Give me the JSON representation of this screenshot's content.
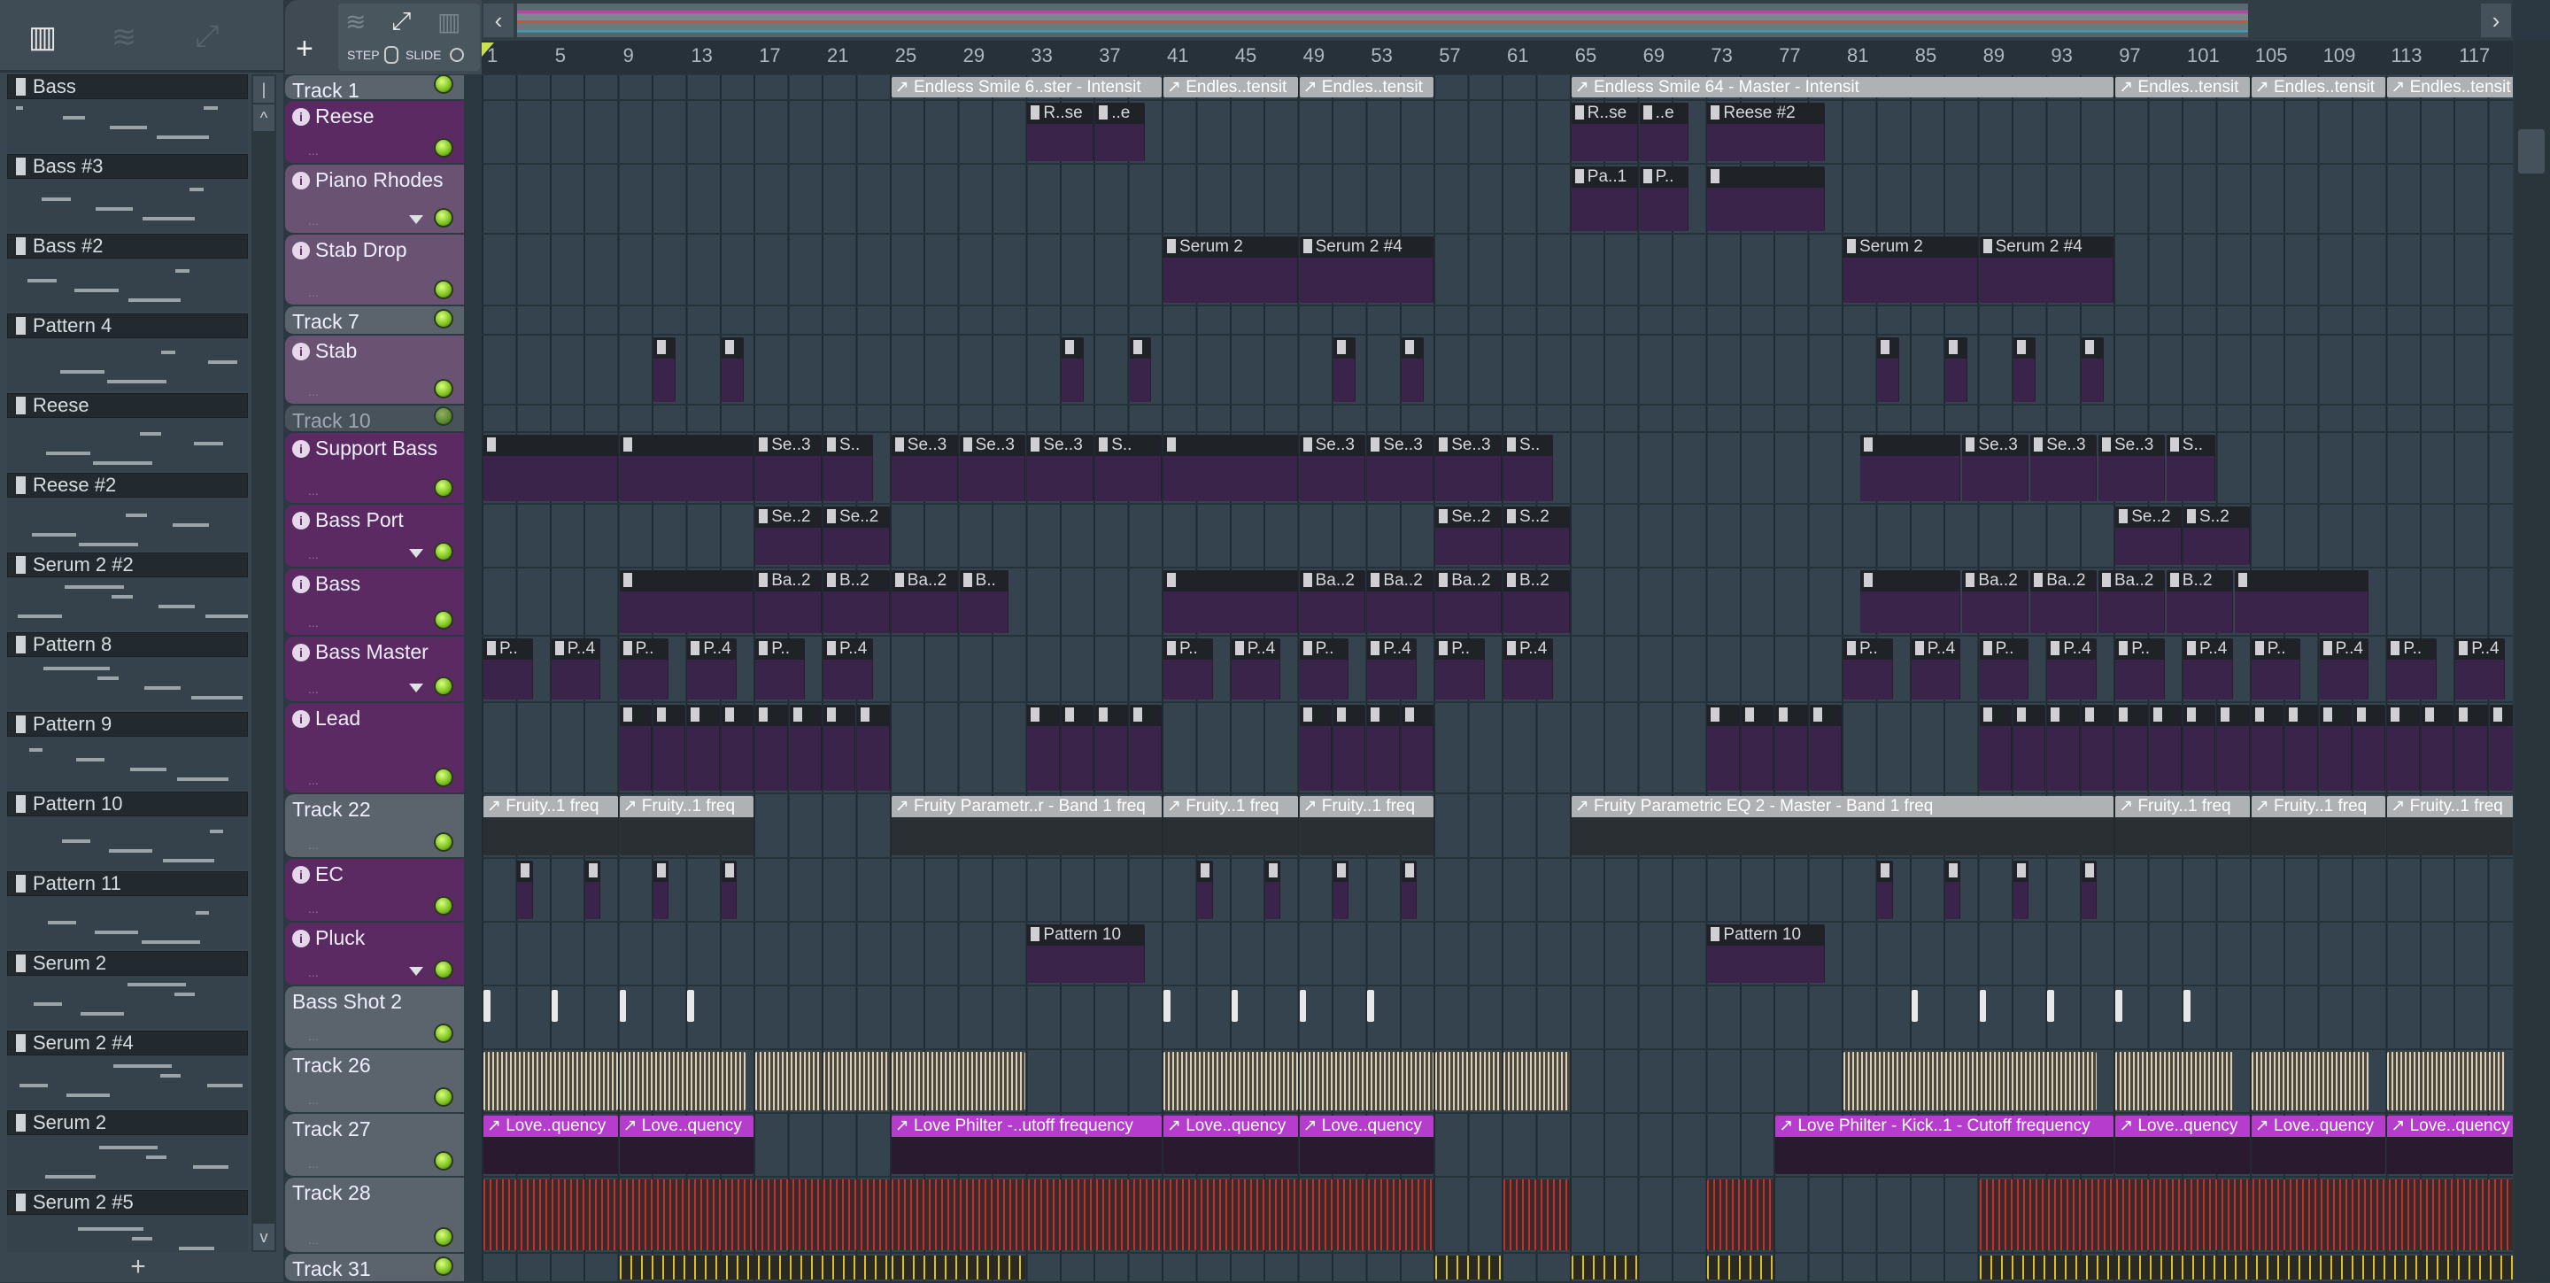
{
  "left_toolbar": {
    "icons": [
      "piano-roll-icon",
      "audio-wave-icon",
      "automation-icon"
    ]
  },
  "pattern_list": [
    "Bass",
    "Bass #3",
    "Bass #2",
    "Pattern 4",
    "Reese",
    "Reese #2",
    "Serum 2 #2",
    "Pattern 8",
    "Pattern 9",
    "Pattern 10",
    "Pattern 11",
    "Serum 2",
    "Serum 2 #4",
    "Serum 2",
    "Serum 2 #5"
  ],
  "pattern_list_add": "+",
  "header": {
    "add": "+",
    "step": "STEP",
    "slide": "SLIDE"
  },
  "ruler": [
    "1",
    "5",
    "9",
    "13",
    "17",
    "21",
    "25",
    "29",
    "33",
    "37",
    "41",
    "45",
    "49",
    "53",
    "57",
    "61",
    "65",
    "69",
    "73",
    "77",
    "81",
    "85",
    "89",
    "93",
    "97",
    "101",
    "105",
    "109",
    "113",
    "117"
  ],
  "colors": {
    "plain": "#5b646c",
    "purple": "#5c2a62",
    "lavender": "#6a5272",
    "accent": "#b53ccc"
  },
  "tracks": [
    {
      "name": "Track 1",
      "kind": "plain",
      "type": "auto",
      "clips": [
        [
          25,
          16,
          "Endless Smile 6..ster - Intensit"
        ],
        [
          41,
          8,
          "Endles..tensit"
        ],
        [
          49,
          8,
          "Endles..tensit"
        ],
        [
          65,
          32,
          "Endless Smile 64 - Master - Intensit"
        ],
        [
          97,
          8,
          "Endles..tensit"
        ],
        [
          105,
          8,
          "Endles..tensit"
        ],
        [
          113,
          8,
          "Endles..tensit"
        ]
      ]
    },
    {
      "name": "Reese",
      "kind": "purple",
      "inst": true,
      "type": "pat",
      "clips": [
        [
          33,
          4,
          "R..se"
        ],
        [
          37,
          3,
          "..e"
        ],
        [
          65,
          4,
          "R..se"
        ],
        [
          69,
          3,
          "..e"
        ],
        [
          73,
          7,
          "Reese #2"
        ]
      ]
    },
    {
      "name": "Piano Rhodes",
      "kind": "lavender",
      "inst": true,
      "type": "pat",
      "clips": [
        [
          65,
          4,
          "Pa..1"
        ],
        [
          69,
          3,
          "P.."
        ],
        [
          73,
          7,
          ""
        ]
      ]
    },
    {
      "name": "Stab Drop",
      "kind": "lavender",
      "inst": true,
      "type": "pat",
      "clips": [
        [
          41,
          8,
          "Serum 2"
        ],
        [
          49,
          8,
          "Serum 2 #4"
        ],
        [
          81,
          8,
          "Serum 2"
        ],
        [
          89,
          8,
          "Serum 2 #4"
        ]
      ]
    },
    {
      "name": "Track 7",
      "kind": "plain",
      "type": "pat",
      "clips": []
    },
    {
      "name": "Stab",
      "kind": "lavender",
      "inst": true,
      "type": "pat",
      "clips": [
        [
          11,
          1.4,
          ""
        ],
        [
          15,
          1.4,
          ""
        ],
        [
          35,
          1.4,
          ""
        ],
        [
          39,
          1.4,
          ""
        ],
        [
          51,
          1.4,
          ""
        ],
        [
          55,
          1.4,
          ""
        ],
        [
          83,
          1.4,
          ""
        ],
        [
          87,
          1.4,
          ""
        ],
        [
          91,
          1.4,
          ""
        ],
        [
          95,
          1.4,
          ""
        ]
      ]
    },
    {
      "name": "Track 10",
      "kind": "plain",
      "dim": true,
      "type": "pat",
      "clips": []
    },
    {
      "name": "Support Bass",
      "kind": "purple",
      "inst": true,
      "type": "pat",
      "clips": [
        [
          1,
          8,
          ""
        ],
        [
          9,
          8,
          ""
        ],
        [
          17,
          4,
          "Se..3"
        ],
        [
          21,
          3,
          "S.."
        ],
        [
          25,
          4,
          "Se..3"
        ],
        [
          29,
          4,
          "Se..3"
        ],
        [
          33,
          4,
          "Se..3"
        ],
        [
          37,
          4,
          "S.."
        ],
        [
          41,
          8,
          ""
        ],
        [
          49,
          4,
          "Se..3"
        ],
        [
          53,
          4,
          "Se..3"
        ],
        [
          57,
          4,
          "Se..3"
        ],
        [
          61,
          3,
          "S.."
        ],
        [
          82,
          6,
          ""
        ],
        [
          88,
          4,
          "Se..3"
        ],
        [
          92,
          4,
          "Se..3"
        ],
        [
          96,
          4,
          "Se..3"
        ],
        [
          100,
          3,
          "S.."
        ]
      ]
    },
    {
      "name": "Bass Port",
      "kind": "purple",
      "inst": true,
      "type": "pat",
      "clips": [
        [
          17,
          4,
          "Se..2"
        ],
        [
          21,
          4,
          "Se..2"
        ],
        [
          57,
          4,
          "Se..2"
        ],
        [
          61,
          4,
          "S..2"
        ],
        [
          97,
          4,
          "Se..2"
        ],
        [
          101,
          4,
          "S..2"
        ]
      ]
    },
    {
      "name": "Bass",
      "kind": "purple",
      "inst": true,
      "type": "pat",
      "clips": [
        [
          9,
          8,
          ""
        ],
        [
          17,
          4,
          "Ba..2"
        ],
        [
          21,
          4,
          "B..2"
        ],
        [
          25,
          4,
          "Ba..2"
        ],
        [
          29,
          3,
          "B.."
        ],
        [
          41,
          8,
          ""
        ],
        [
          49,
          4,
          "Ba..2"
        ],
        [
          53,
          4,
          "Ba..2"
        ],
        [
          57,
          4,
          "Ba..2"
        ],
        [
          61,
          4,
          "B..2"
        ],
        [
          82,
          6,
          ""
        ],
        [
          88,
          4,
          "Ba..2"
        ],
        [
          92,
          4,
          "Ba..2"
        ],
        [
          96,
          4,
          "Ba..2"
        ],
        [
          100,
          4,
          "B..2"
        ],
        [
          104,
          8,
          ""
        ]
      ]
    },
    {
      "name": "Bass Master",
      "kind": "purple",
      "inst": true,
      "type": "pat",
      "clips": [
        [
          1,
          3,
          "P.."
        ],
        [
          5,
          3,
          "P..4"
        ],
        [
          9,
          3,
          "P.."
        ],
        [
          13,
          3,
          "P..4"
        ],
        [
          17,
          3,
          "P.."
        ],
        [
          21,
          3,
          "P..4"
        ],
        [
          41,
          3,
          "P.."
        ],
        [
          45,
          3,
          "P..4"
        ],
        [
          49,
          3,
          "P.."
        ],
        [
          53,
          3,
          "P..4"
        ],
        [
          57,
          3,
          "P.."
        ],
        [
          61,
          3,
          "P..4"
        ],
        [
          81,
          3,
          "P.."
        ],
        [
          85,
          3,
          "P..4"
        ],
        [
          89,
          3,
          "P.."
        ],
        [
          93,
          3,
          "P..4"
        ],
        [
          97,
          3,
          "P.."
        ],
        [
          101,
          3,
          "P..4"
        ],
        [
          105,
          3,
          "P.."
        ],
        [
          109,
          3,
          "P..4"
        ],
        [
          113,
          3,
          "P.."
        ],
        [
          117,
          3,
          "P..4"
        ]
      ]
    },
    {
      "name": "Lead",
      "kind": "purple",
      "inst": true,
      "type": "pat",
      "clips": [
        [
          9,
          2,
          ""
        ],
        [
          11,
          2,
          ""
        ],
        [
          13,
          2,
          ""
        ],
        [
          15,
          2,
          ""
        ],
        [
          17,
          2,
          ""
        ],
        [
          19,
          2,
          ""
        ],
        [
          21,
          2,
          ""
        ],
        [
          23,
          2,
          ""
        ],
        [
          33,
          2,
          ""
        ],
        [
          35,
          2,
          ""
        ],
        [
          37,
          2,
          ""
        ],
        [
          39,
          2,
          ""
        ],
        [
          49,
          2,
          ""
        ],
        [
          51,
          2,
          ""
        ],
        [
          53,
          2,
          ""
        ],
        [
          55,
          2,
          ""
        ],
        [
          73,
          2,
          ""
        ],
        [
          75,
          2,
          ""
        ],
        [
          77,
          2,
          ""
        ],
        [
          79,
          2,
          ""
        ],
        [
          89,
          2,
          ""
        ],
        [
          91,
          2,
          ""
        ],
        [
          93,
          2,
          ""
        ],
        [
          95,
          2,
          ""
        ],
        [
          97,
          2,
          ""
        ],
        [
          99,
          2,
          ""
        ],
        [
          101,
          2,
          ""
        ],
        [
          103,
          2,
          ""
        ],
        [
          105,
          2,
          ""
        ],
        [
          107,
          2,
          ""
        ],
        [
          109,
          2,
          ""
        ],
        [
          111,
          2,
          ""
        ],
        [
          113,
          2,
          ""
        ],
        [
          115,
          2,
          ""
        ],
        [
          117,
          2,
          ""
        ],
        [
          119,
          2,
          ""
        ]
      ]
    },
    {
      "name": "Track 22",
      "kind": "plain",
      "type": "auto",
      "clips": [
        [
          1,
          8,
          "Fruity..1 freq"
        ],
        [
          9,
          8,
          "Fruity..1 freq"
        ],
        [
          25,
          16,
          "Fruity Parametr..r - Band 1 freq"
        ],
        [
          41,
          8,
          "Fruity..1 freq"
        ],
        [
          49,
          8,
          "Fruity..1 freq"
        ],
        [
          65,
          32,
          "Fruity Parametric EQ 2 - Master - Band 1 freq"
        ],
        [
          97,
          8,
          "Fruity..1 freq"
        ],
        [
          105,
          8,
          "Fruity..1 freq"
        ],
        [
          113,
          8,
          "Fruity..1 freq"
        ]
      ]
    },
    {
      "name": "EC",
      "kind": "purple",
      "inst": true,
      "type": "pat",
      "clips": [
        [
          3,
          1,
          ""
        ],
        [
          7,
          1,
          ""
        ],
        [
          11,
          1,
          ""
        ],
        [
          15,
          1,
          ""
        ],
        [
          43,
          1,
          ""
        ],
        [
          47,
          1,
          ""
        ],
        [
          51,
          1,
          ""
        ],
        [
          55,
          1,
          ""
        ],
        [
          83,
          1,
          ""
        ],
        [
          87,
          1,
          ""
        ],
        [
          91,
          1,
          ""
        ],
        [
          95,
          1,
          ""
        ]
      ]
    },
    {
      "name": "Pluck",
      "kind": "purple",
      "inst": true,
      "type": "pat",
      "clips": [
        [
          33,
          7,
          "Pattern 10"
        ],
        [
          73,
          7,
          "Pattern 10"
        ]
      ]
    },
    {
      "name": "Bass Shot 2",
      "kind": "plain",
      "type": "shot",
      "clips": [
        [
          1,
          0.5,
          ""
        ],
        [
          5,
          0.5,
          ""
        ],
        [
          9,
          0.5,
          ""
        ],
        [
          13,
          0.5,
          ""
        ],
        [
          41,
          0.5,
          ""
        ],
        [
          45,
          0.5,
          ""
        ],
        [
          49,
          0.5,
          ""
        ],
        [
          53,
          0.5,
          ""
        ],
        [
          85,
          0.5,
          ""
        ],
        [
          89,
          0.5,
          ""
        ],
        [
          93,
          0.5,
          ""
        ],
        [
          97,
          0.5,
          ""
        ],
        [
          101,
          0.5,
          ""
        ]
      ]
    },
    {
      "name": "Track 26",
      "kind": "plain",
      "type": "audio",
      "clips": [
        [
          1,
          8,
          ""
        ],
        [
          9,
          7.5,
          ""
        ],
        [
          17,
          4,
          ""
        ],
        [
          21,
          4,
          ""
        ],
        [
          25,
          8,
          ""
        ],
        [
          41,
          8,
          ""
        ],
        [
          49,
          8,
          ""
        ],
        [
          57,
          4,
          ""
        ],
        [
          61,
          4,
          ""
        ],
        [
          81,
          15,
          ""
        ],
        [
          97,
          7,
          ""
        ],
        [
          105,
          7,
          ""
        ],
        [
          113,
          7,
          ""
        ]
      ]
    },
    {
      "name": "Track 27",
      "kind": "plain",
      "type": "automag",
      "clips": [
        [
          1,
          8,
          "Love..quency"
        ],
        [
          9,
          8,
          "Love..quency"
        ],
        [
          25,
          16,
          "Love Philter -..utoff frequency"
        ],
        [
          41,
          8,
          "Love..quency"
        ],
        [
          49,
          8,
          "Love..quency"
        ],
        [
          77,
          20,
          "Love Philter - Kick..1 - Cutoff frequency"
        ],
        [
          97,
          8,
          "Love..quency"
        ],
        [
          105,
          8,
          "Love..quency"
        ],
        [
          113,
          8,
          "Love..quency"
        ]
      ]
    },
    {
      "name": "Track 28",
      "kind": "plain",
      "type": "red",
      "clips": [
        [
          1,
          16,
          ""
        ],
        [
          17,
          8,
          ""
        ],
        [
          25,
          16,
          ""
        ],
        [
          41,
          16,
          ""
        ],
        [
          61,
          4,
          ""
        ],
        [
          73,
          4,
          ""
        ],
        [
          89,
          32,
          ""
        ]
      ]
    },
    {
      "name": "Track 31",
      "kind": "plain",
      "type": "yel",
      "clips": [
        [
          9,
          16,
          ""
        ],
        [
          25,
          8,
          ""
        ],
        [
          57,
          4,
          ""
        ],
        [
          65,
          4,
          ""
        ],
        [
          73,
          4,
          ""
        ],
        [
          89,
          32,
          ""
        ]
      ]
    }
  ]
}
